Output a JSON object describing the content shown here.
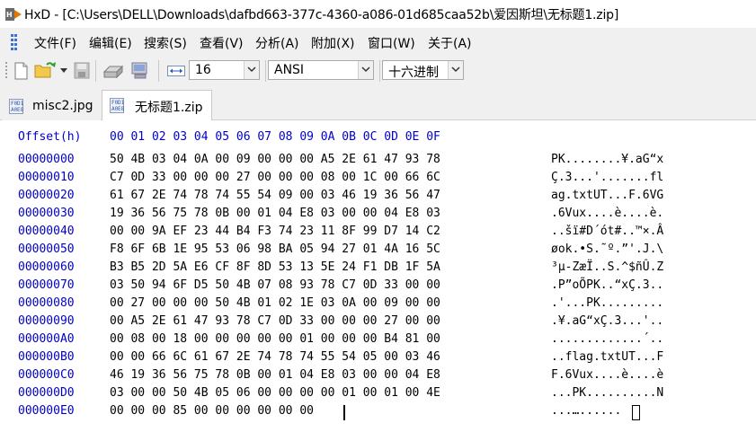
{
  "window": {
    "title": "HxD - [C:\\Users\\DELL\\Downloads\\dafbd663-377c-4360-a086-01d685caa52b\\爱因斯坦\\无标题1.zip]"
  },
  "menu": {
    "items": [
      "文件(F)",
      "编辑(E)",
      "搜索(S)",
      "查看(V)",
      "分析(A)",
      "附加(X)",
      "窗口(W)",
      "关于(A)"
    ]
  },
  "toolbar": {
    "bytes_per_row": "16",
    "charset": "ANSI",
    "offset_base": "十六进制"
  },
  "tabs": [
    {
      "label": "misc2.jpg",
      "active": false
    },
    {
      "label": "无标题1.zip",
      "active": true
    }
  ],
  "editor": {
    "header_offset_label": "Offset(h)",
    "header_columns": "00 01 02 03 04 05 06 07 08 09 0A 0B 0C 0D 0E 0F",
    "rows": [
      {
        "offset": "00000000",
        "hex": "50 4B 03 04 0A 00 09 00 00 00 A5 2E 61 47 93 78",
        "ascii": "PK........¥.aG“x"
      },
      {
        "offset": "00000010",
        "hex": "C7 0D 33 00 00 00 27 00 00 00 08 00 1C 00 66 6C",
        "ascii": "Ç.3...'.......fl"
      },
      {
        "offset": "00000020",
        "hex": "61 67 2E 74 78 74 55 54 09 00 03 46 19 36 56 47",
        "ascii": "ag.txtUT...F.6VG"
      },
      {
        "offset": "00000030",
        "hex": "19 36 56 75 78 0B 00 01 04 E8 03 00 00 04 E8 03",
        "ascii": ".6Vux....è....è."
      },
      {
        "offset": "00000040",
        "hex": "00 00 9A EF 23 44 B4 F3 74 23 11 8F 99 D7 14 C2",
        "ascii": "..šï#D´ót#..™×.Â"
      },
      {
        "offset": "00000050",
        "hex": "F8 6F 6B 1E 95 53 06 98 BA 05 94 27 01 4A 16 5C",
        "ascii": "øok.•S.˜º.”'.J.\\"
      },
      {
        "offset": "00000060",
        "hex": "B3 B5 2D 5A E6 CF 8F 8D 53 13 5E 24 F1 DB 1F 5A",
        "ascii": "³µ-ZæÏ..S.^$ñÛ.Z"
      },
      {
        "offset": "00000070",
        "hex": "03 50 94 6F D5 50 4B 07 08 93 78 C7 0D 33 00 00",
        "ascii": ".P”oÕPK..“xÇ.3.."
      },
      {
        "offset": "00000080",
        "hex": "00 27 00 00 00 50 4B 01 02 1E 03 0A 00 09 00 00",
        "ascii": ".'...PK........."
      },
      {
        "offset": "00000090",
        "hex": "00 A5 2E 61 47 93 78 C7 0D 33 00 00 00 27 00 00",
        "ascii": ".¥.aG“xÇ.3...'.."
      },
      {
        "offset": "000000A0",
        "hex": "00 08 00 18 00 00 00 00 00 01 00 00 00 B4 81 00",
        "ascii": ".............´.."
      },
      {
        "offset": "000000B0",
        "hex": "00 00 66 6C 61 67 2E 74 78 74 55 54 05 00 03 46",
        "ascii": "..flag.txtUT...F"
      },
      {
        "offset": "000000C0",
        "hex": "46 19 36 56 75 78 0B 00 01 04 E8 03 00 00 04 E8",
        "ascii": "F.6Vux....è....è"
      },
      {
        "offset": "000000D0",
        "hex": "03 00 00 50 4B 05 06 00 00 00 00 01 00 01 00 4E",
        "ascii": "...PK..........N"
      },
      {
        "offset": "000000E0",
        "hex": "00 00 00 85 00 00 00 00 00 00",
        "ascii": "...…......"
      }
    ]
  },
  "colors": {
    "offset_blue": "#0000c8",
    "bar_gray": "#f0f0f0"
  }
}
